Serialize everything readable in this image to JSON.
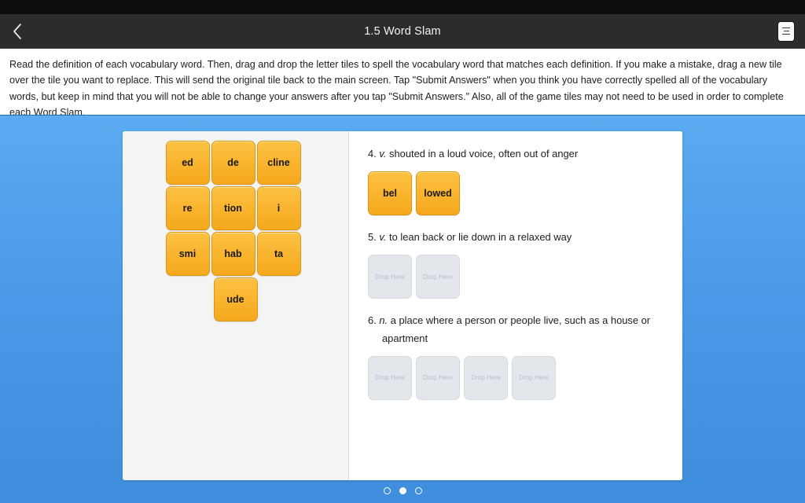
{
  "header": {
    "title": "1.5 Word Slam",
    "back_icon": "chevron-left-icon",
    "menu_icon": "menu-icon"
  },
  "instructions": {
    "text": "Read the definition of each vocabulary word. Then, drag and drop the letter tiles to spell the vocabulary word that matches each definition. If you make a mistake, drag a new tile over the tile you want to replace. This will send the original tile back to the main screen. Tap \"Submit Answers\" when you think you have correctly spelled all of the vocabulary words, but keep in mind that you will not be able to change your answers after you tap \"Submit Answers.\" Also, all of the game tiles may not need to be used in order to complete each Word Slam."
  },
  "tile_bank": {
    "tiles": [
      {
        "label": "ed"
      },
      {
        "label": "de"
      },
      {
        "label": "cline"
      },
      {
        "label": "re"
      },
      {
        "label": "tion"
      },
      {
        "label": "i"
      },
      {
        "label": "smi"
      },
      {
        "label": "hab"
      },
      {
        "label": "ta"
      },
      {
        "label": "ude"
      }
    ]
  },
  "definitions": [
    {
      "number": "4.",
      "pos": "v.",
      "text": "shouted in a loud voice, often out of anger",
      "slots": [
        {
          "filled": true,
          "label": "bel"
        },
        {
          "filled": true,
          "label": "lowed"
        }
      ]
    },
    {
      "number": "5.",
      "pos": "v.",
      "text": "to lean back or lie down in a relaxed way",
      "slots": [
        {
          "filled": false,
          "label": "Drop Here"
        },
        {
          "filled": false,
          "label": "Drop Here"
        }
      ]
    },
    {
      "number": "6.",
      "pos": "n.",
      "text": "a place where a person or people live, such as a house or apartment",
      "slots": [
        {
          "filled": false,
          "label": "Drop Here"
        },
        {
          "filled": false,
          "label": "Drop Here"
        },
        {
          "filled": false,
          "label": "Drop Here"
        },
        {
          "filled": false,
          "label": "Drop Here"
        }
      ]
    }
  ],
  "pager": {
    "total": 3,
    "active_index": 1
  },
  "colors": {
    "tile": "#f5a81c",
    "slot": "#e3e6eb",
    "stage_top": "#5aabf0",
    "stage_bottom": "#3f8ede",
    "title_bar": "#2c2c2c"
  }
}
